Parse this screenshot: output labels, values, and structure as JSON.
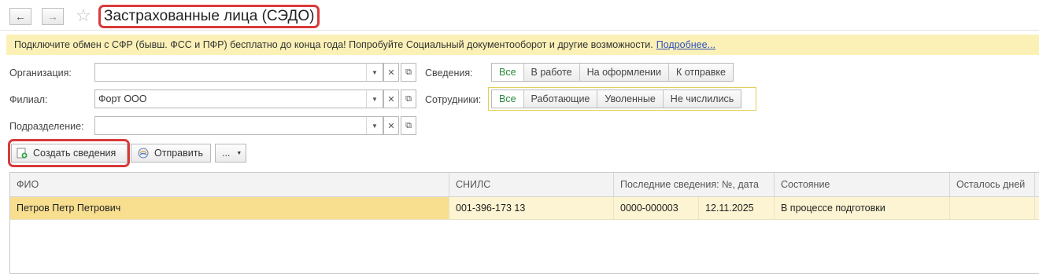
{
  "header": {
    "back_glyph": "←",
    "forward_glyph": "→",
    "title": "Застрахованные лица (СЭДО)"
  },
  "banner": {
    "text": "Подключите обмен с СФР (бывш. ФСС и ПФР) бесплатно до конца года! Попробуйте Социальный документооборот и другие возможности.",
    "link": "Подробнее..."
  },
  "form": {
    "organization_label": "Организация:",
    "organization_value": "",
    "branch_label": "Филиал:",
    "branch_value": "Форт ООО",
    "division_label": "Подразделение:",
    "division_value": ""
  },
  "filters": {
    "svedeniya_label": "Сведения:",
    "svedeniya_options": [
      "Все",
      "В работе",
      "На оформлении",
      "К отправке"
    ],
    "sotrudniki_label": "Сотрудники:",
    "sotrudniki_options": [
      "Все",
      "Работающие",
      "Уволенные",
      "Не числились"
    ]
  },
  "toolbar": {
    "create_label": "Создать сведения",
    "send_label": "Отправить",
    "more_label": "..."
  },
  "table": {
    "columns": [
      "ФИО",
      "СНИЛС",
      "Последние сведения: №, дата",
      "Состояние",
      "Осталось дней"
    ],
    "rows": [
      {
        "fio": "Петров Петр Петрович",
        "snils": "001-396-173 13",
        "number": "0000-000003",
        "date": "12.11.2025",
        "state": "В процессе подготовки",
        "days": ""
      }
    ]
  },
  "colors": {
    "highlight_red": "#d93a3a",
    "banner_bg": "#fbf1b7",
    "row_bg": "#fcf4d2",
    "selected_cell": "#f8df8f",
    "active_option": "#2a8a3c"
  }
}
